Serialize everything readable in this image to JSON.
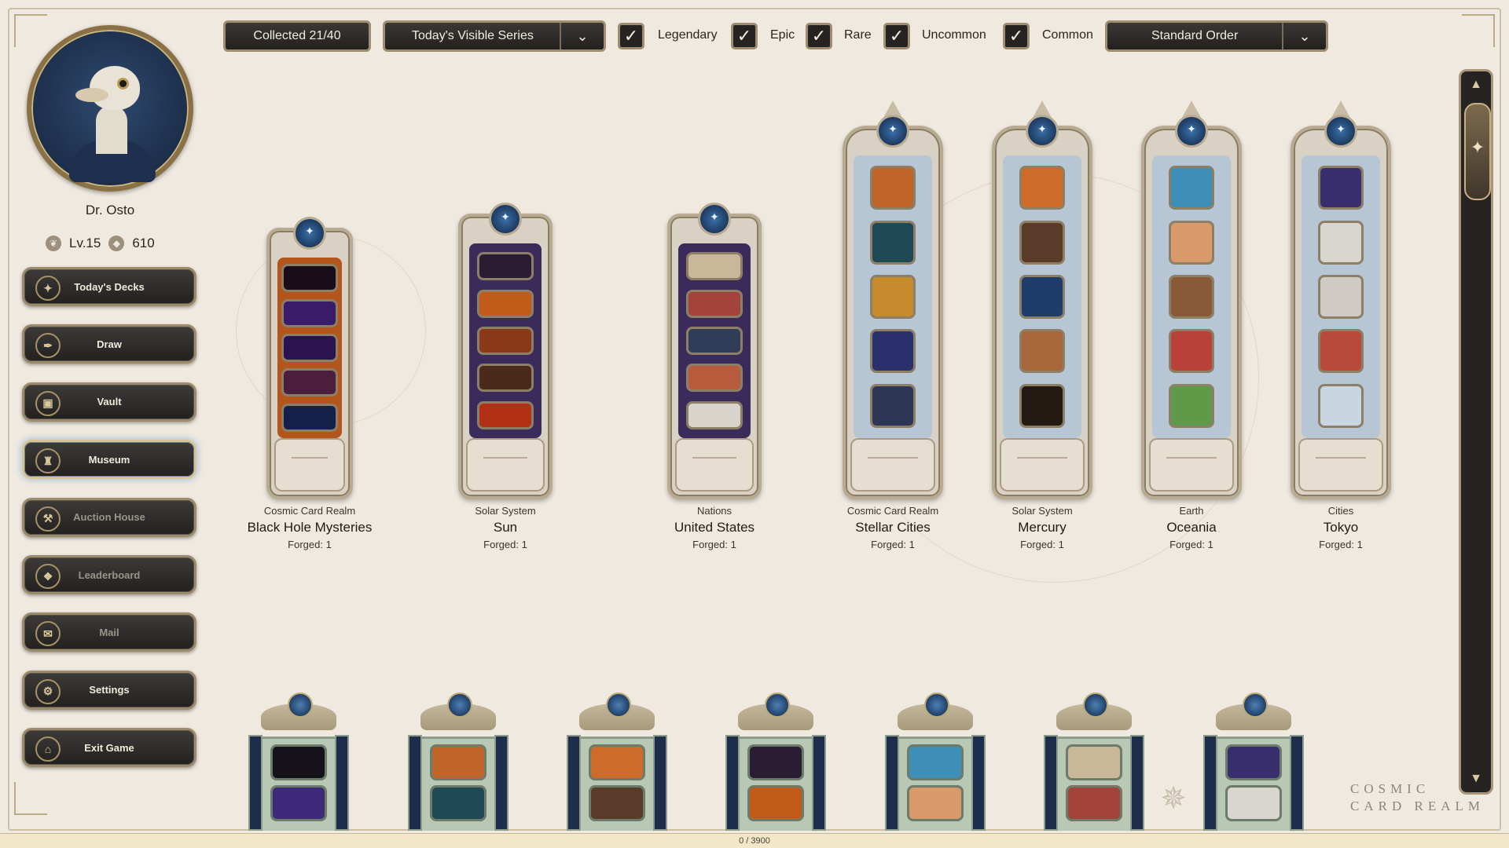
{
  "player": {
    "name": "Dr. Osto",
    "level": "Lv.15",
    "currency": "610"
  },
  "nav": [
    {
      "label": "Today's Decks",
      "icon": "compass-icon",
      "glyph": "✦",
      "enabled": true
    },
    {
      "label": "Draw",
      "icon": "quill-icon",
      "glyph": "✒",
      "enabled": true
    },
    {
      "label": "Vault",
      "icon": "chest-icon",
      "glyph": "▣",
      "enabled": true
    },
    {
      "label": "Museum",
      "icon": "bell-jar-icon",
      "glyph": "♜",
      "enabled": true,
      "active": true
    },
    {
      "label": "Auction House",
      "icon": "gavel-icon",
      "glyph": "⚒",
      "enabled": false
    },
    {
      "label": "Leaderboard",
      "icon": "emblem-icon",
      "glyph": "❖",
      "enabled": false
    },
    {
      "label": "Mail",
      "icon": "envelope-icon",
      "glyph": "✉",
      "enabled": false
    },
    {
      "label": "Settings",
      "icon": "gear-icon",
      "glyph": "⚙",
      "enabled": true
    },
    {
      "label": "Exit Game",
      "icon": "portal-icon",
      "glyph": "⌂",
      "enabled": true
    }
  ],
  "topbar": {
    "collected": "Collected 21/40",
    "series_filter": "Today's Visible Series",
    "rarity_filters": [
      {
        "label": "Legendary",
        "checked": true
      },
      {
        "label": "Epic",
        "checked": true
      },
      {
        "label": "Rare",
        "checked": true
      },
      {
        "label": "Uncommon",
        "checked": true
      },
      {
        "label": "Common",
        "checked": true
      }
    ],
    "sort_order": "Standard Order"
  },
  "decks": [
    {
      "series": "Cosmic Card Realm",
      "name": "Black Hole Mysteries",
      "forged": "Forged: 1",
      "tier": "orange",
      "slots": [
        "#1a0d1a",
        "#3b1c6b",
        "#2b1250",
        "#4b1e3e",
        "#14204a"
      ]
    },
    {
      "series": "Solar System",
      "name": "Sun",
      "forged": "Forged: 1",
      "tier": "purple",
      "slots": [
        "#2a1d33",
        "#c25a1a",
        "#8a3a18",
        "#4a2a1a",
        "#b23116"
      ]
    },
    {
      "series": "Nations",
      "name": "United States",
      "forged": "Forged: 1",
      "tier": "purple",
      "slots": [
        "#c8b899",
        "#a4433c",
        "#2f3d58",
        "#b85a3c",
        "#d9d4cb"
      ]
    },
    {
      "series": "Cosmic Card Realm",
      "name": "Stellar Cities",
      "forged": "Forged: 1",
      "tier": "tall",
      "slots": [
        "#c0652a",
        "#1f4a55",
        "#c58b2d",
        "#2a2f6e",
        "#2c3554"
      ]
    },
    {
      "series": "Solar System",
      "name": "Mercury",
      "forged": "Forged: 1",
      "tier": "tall",
      "slots": [
        "#cf6b2a",
        "#5a3b2a",
        "#1e3d6a",
        "#a7673a",
        "#241a14"
      ]
    },
    {
      "series": "Earth",
      "name": "Oceania",
      "forged": "Forged: 1",
      "tier": "tall",
      "slots": [
        "#3e8fb8",
        "#d89a6a",
        "#8a5a38",
        "#b8413a",
        "#5f9a48"
      ]
    },
    {
      "series": "Cities",
      "name": "Tokyo",
      "forged": "Forged: 1",
      "tier": "tall",
      "slots": [
        "#3a2f6e",
        "#d9d6d0",
        "#cfcbc4",
        "#b84a3a",
        "#c9d6e2"
      ]
    }
  ],
  "shrines": [
    {
      "slots": [
        "#16121a",
        "#3d2a7a"
      ]
    },
    {
      "slots": [
        "#c0652a",
        "#1f4a55"
      ]
    },
    {
      "slots": [
        "#cf6b2a",
        "#5a3b2a"
      ]
    },
    {
      "slots": [
        "#2a1d33",
        "#c25a1a"
      ]
    },
    {
      "slots": [
        "#3e8fb8",
        "#d89a6a"
      ]
    },
    {
      "slots": [
        "#c8b899",
        "#a4433c"
      ]
    },
    {
      "slots": [
        "#3a2f6e",
        "#d9d6d0"
      ]
    }
  ],
  "logo": {
    "line1": "COSMIC",
    "line2": "CARD REALM"
  },
  "status": "0 / 3900",
  "colors": {
    "accent_gold": "#9e8d70",
    "dark_panel": "#262422",
    "background": "#efe9e0"
  }
}
